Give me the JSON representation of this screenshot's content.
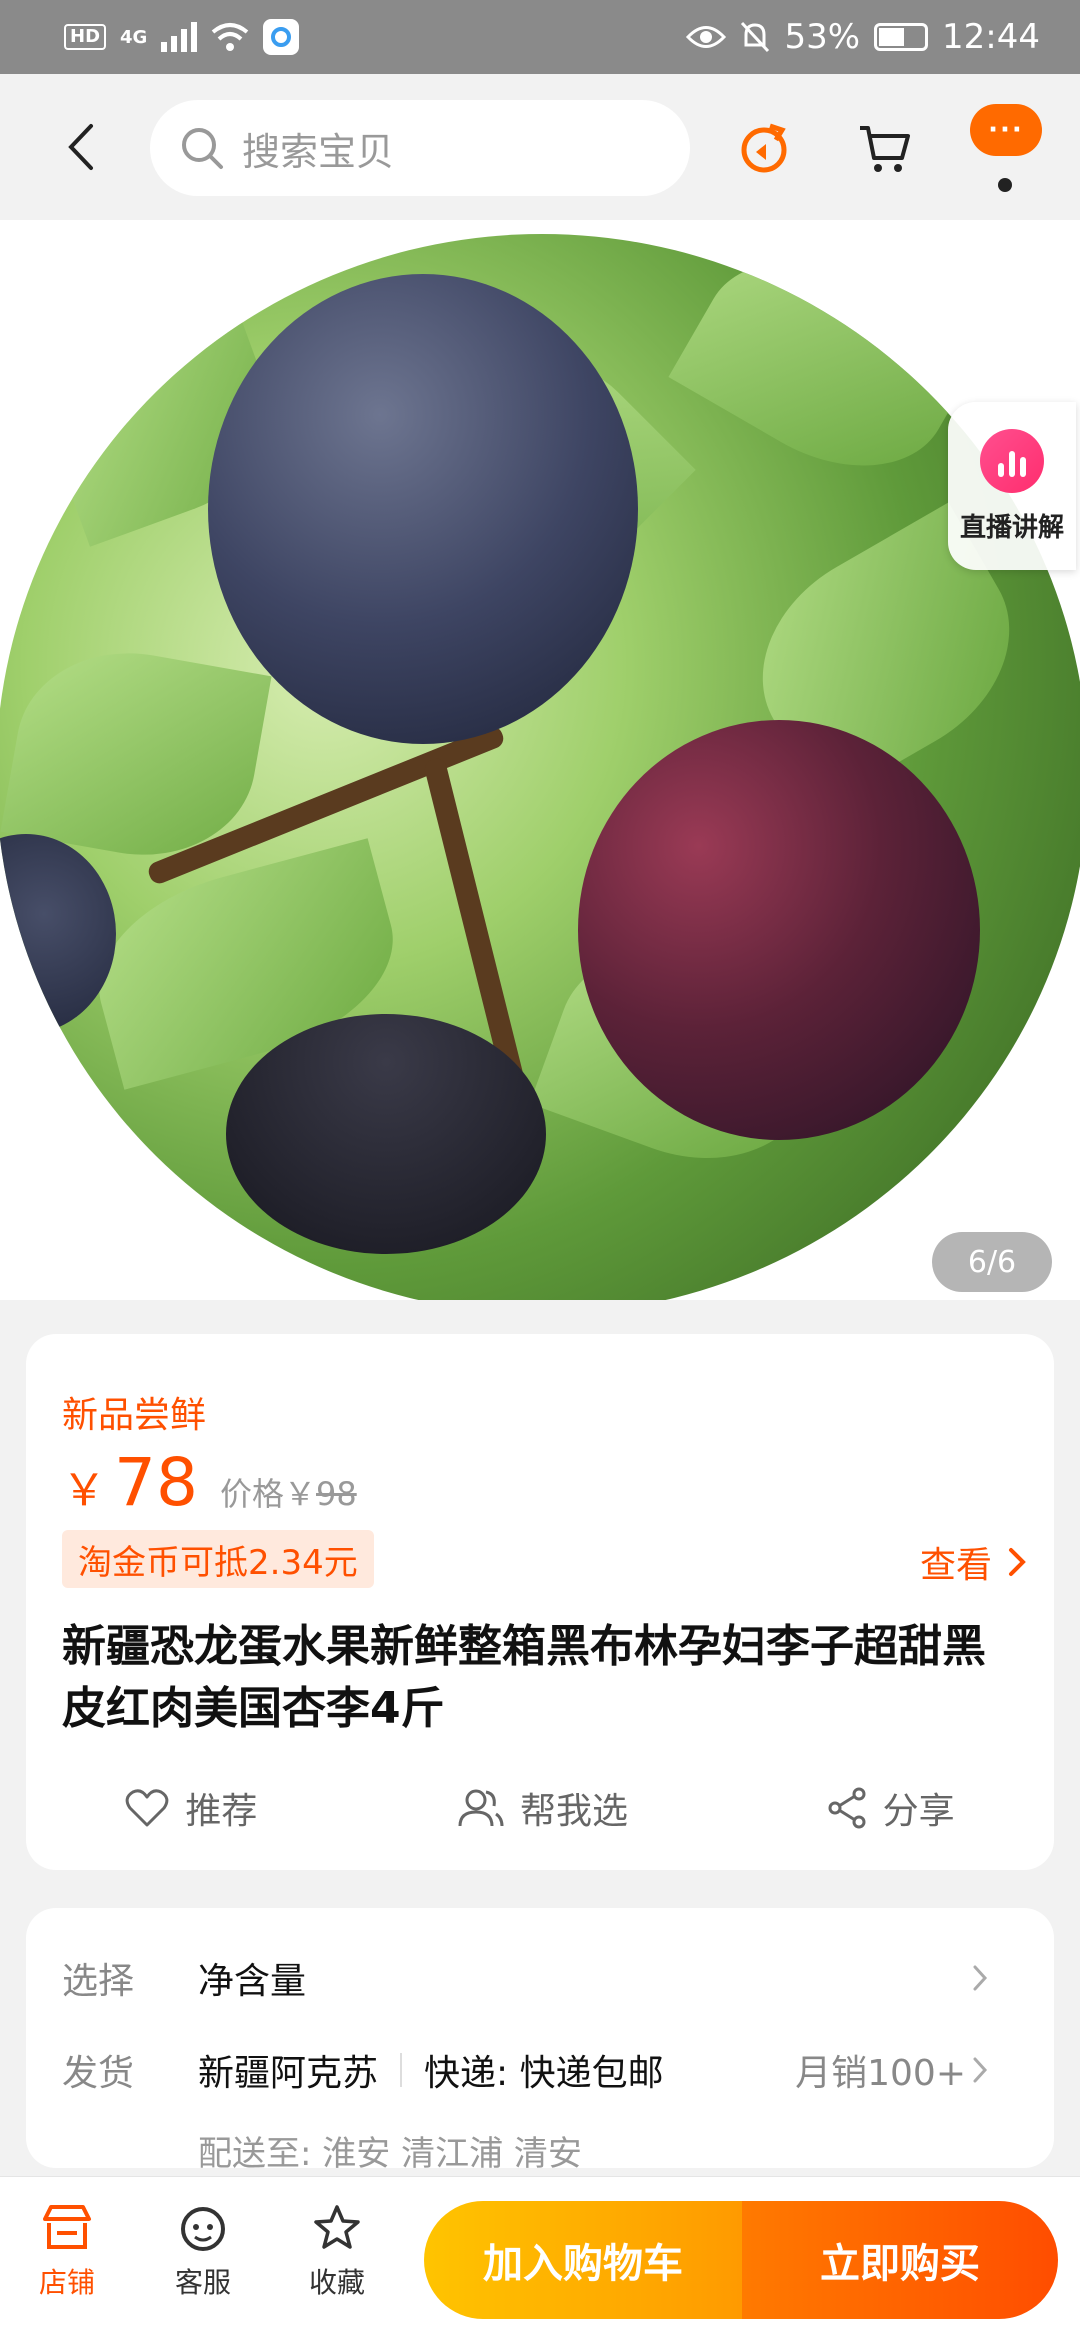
{
  "status_bar": {
    "network": "4G",
    "battery": "53%",
    "time": "12:44"
  },
  "nav": {
    "search_placeholder": "搜索宝贝",
    "more_label": "···"
  },
  "gallery": {
    "live_label": "直播讲解",
    "counter": "6/6"
  },
  "product": {
    "tag": "新品尝鲜",
    "currency": "￥",
    "price": "78",
    "original_price_label": "价格￥",
    "original_price": "98",
    "coin_text": "淘金币可抵2.34元",
    "view_label": "查看",
    "title": "新疆恐龙蛋水果新鲜整箱黑布林孕妇李子超甜黑皮红肉美国杏李4斤"
  },
  "actions": [
    {
      "label": "推荐",
      "icon": "heart-icon"
    },
    {
      "label": "帮我选",
      "icon": "people-icon"
    },
    {
      "label": "分享",
      "icon": "share-icon"
    }
  ],
  "specs": {
    "select_key": "选择",
    "select_value": "净含量",
    "ship_key": "发货",
    "ship_origin": "新疆阿克苏",
    "ship_method": "快递: 快递包邮",
    "monthly_sales": "月销100+",
    "deliver_to": "配送至: 淮安 清江浦 清安"
  },
  "bottom_bar": {
    "shop": "店铺",
    "service": "客服",
    "favorite": "收藏",
    "add_to_cart": "加入购物车",
    "buy_now": "立即购买"
  },
  "colors": {
    "accent": "#ff5000",
    "cart_start": "#ffc400",
    "buy_end": "#ff4d00"
  }
}
